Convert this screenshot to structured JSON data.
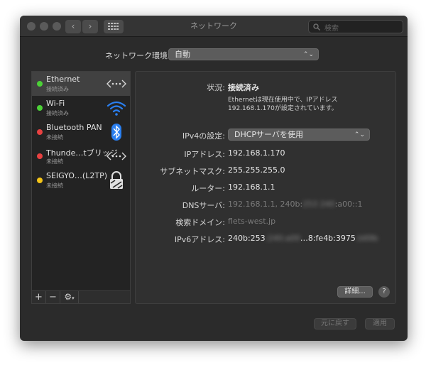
{
  "window": {
    "title": "ネットワーク",
    "search_placeholder": "検索"
  },
  "location": {
    "label": "ネットワーク環境:",
    "value": "自動"
  },
  "sidebar": {
    "items": [
      {
        "name": "Ethernet",
        "status": "接続済み",
        "dot": "#4cd137",
        "icon": "ethernet-arrows-icon",
        "selected": true
      },
      {
        "name": "Wi-Fi",
        "status": "接続済み",
        "dot": "#4cd137",
        "icon": "wifi-icon",
        "selected": false
      },
      {
        "name": "Bluetooth PAN",
        "status": "未接続",
        "dot": "#e84141",
        "icon": "bluetooth-icon",
        "selected": false
      },
      {
        "name": "Thunde…tブリッジ",
        "status": "未接続",
        "dot": "#e84141",
        "icon": "ethernet-arrows-icon",
        "selected": false
      },
      {
        "name": "SEIGYO…(L2TP)",
        "status": "未接続",
        "dot": "#f5c518",
        "icon": "vpn-lock-icon",
        "selected": false
      }
    ],
    "add": "+",
    "remove": "−",
    "gear": "⚙"
  },
  "details": {
    "status_label": "状況:",
    "status_value": "接続済み",
    "status_desc_1": "Ethernetは現在使用中で、IPアドレス",
    "status_desc_2": "192.168.1.170が設定されています。",
    "ipv4_label": "IPv4の設定:",
    "ipv4_value": "DHCPサーバを使用",
    "ip_label": "IPアドレス:",
    "ip_value": "192.168.1.170",
    "subnet_label": "サブネットマスク:",
    "subnet_value": "255.255.255.0",
    "router_label": "ルーター:",
    "router_value": "192.168.1.1",
    "dns_label": "DNSサーバ:",
    "dns_value_a": "192.168.1.1, 240b:",
    "dns_value_blur": "253 240",
    "dns_value_b": ":a00::1",
    "domain_label": "検索ドメイン:",
    "domain_value": "flets-west.jp",
    "ipv6_label": "IPv6アドレス:",
    "ipv6_value_a": "240b:253",
    "ipv6_value_blur": ":240:a00",
    "ipv6_value_b": "…8:fe4b:3975",
    "ipv6_value_blur2": ":b69b",
    "advanced_button": "詳細...",
    "help": "?"
  },
  "footer": {
    "revert_button": "元に戻す",
    "apply_button": "適用"
  },
  "colors": {
    "connected": "#4cd137",
    "disconnected": "#e84141",
    "vpn": "#f5c518",
    "accent": "#2a7ff0"
  }
}
